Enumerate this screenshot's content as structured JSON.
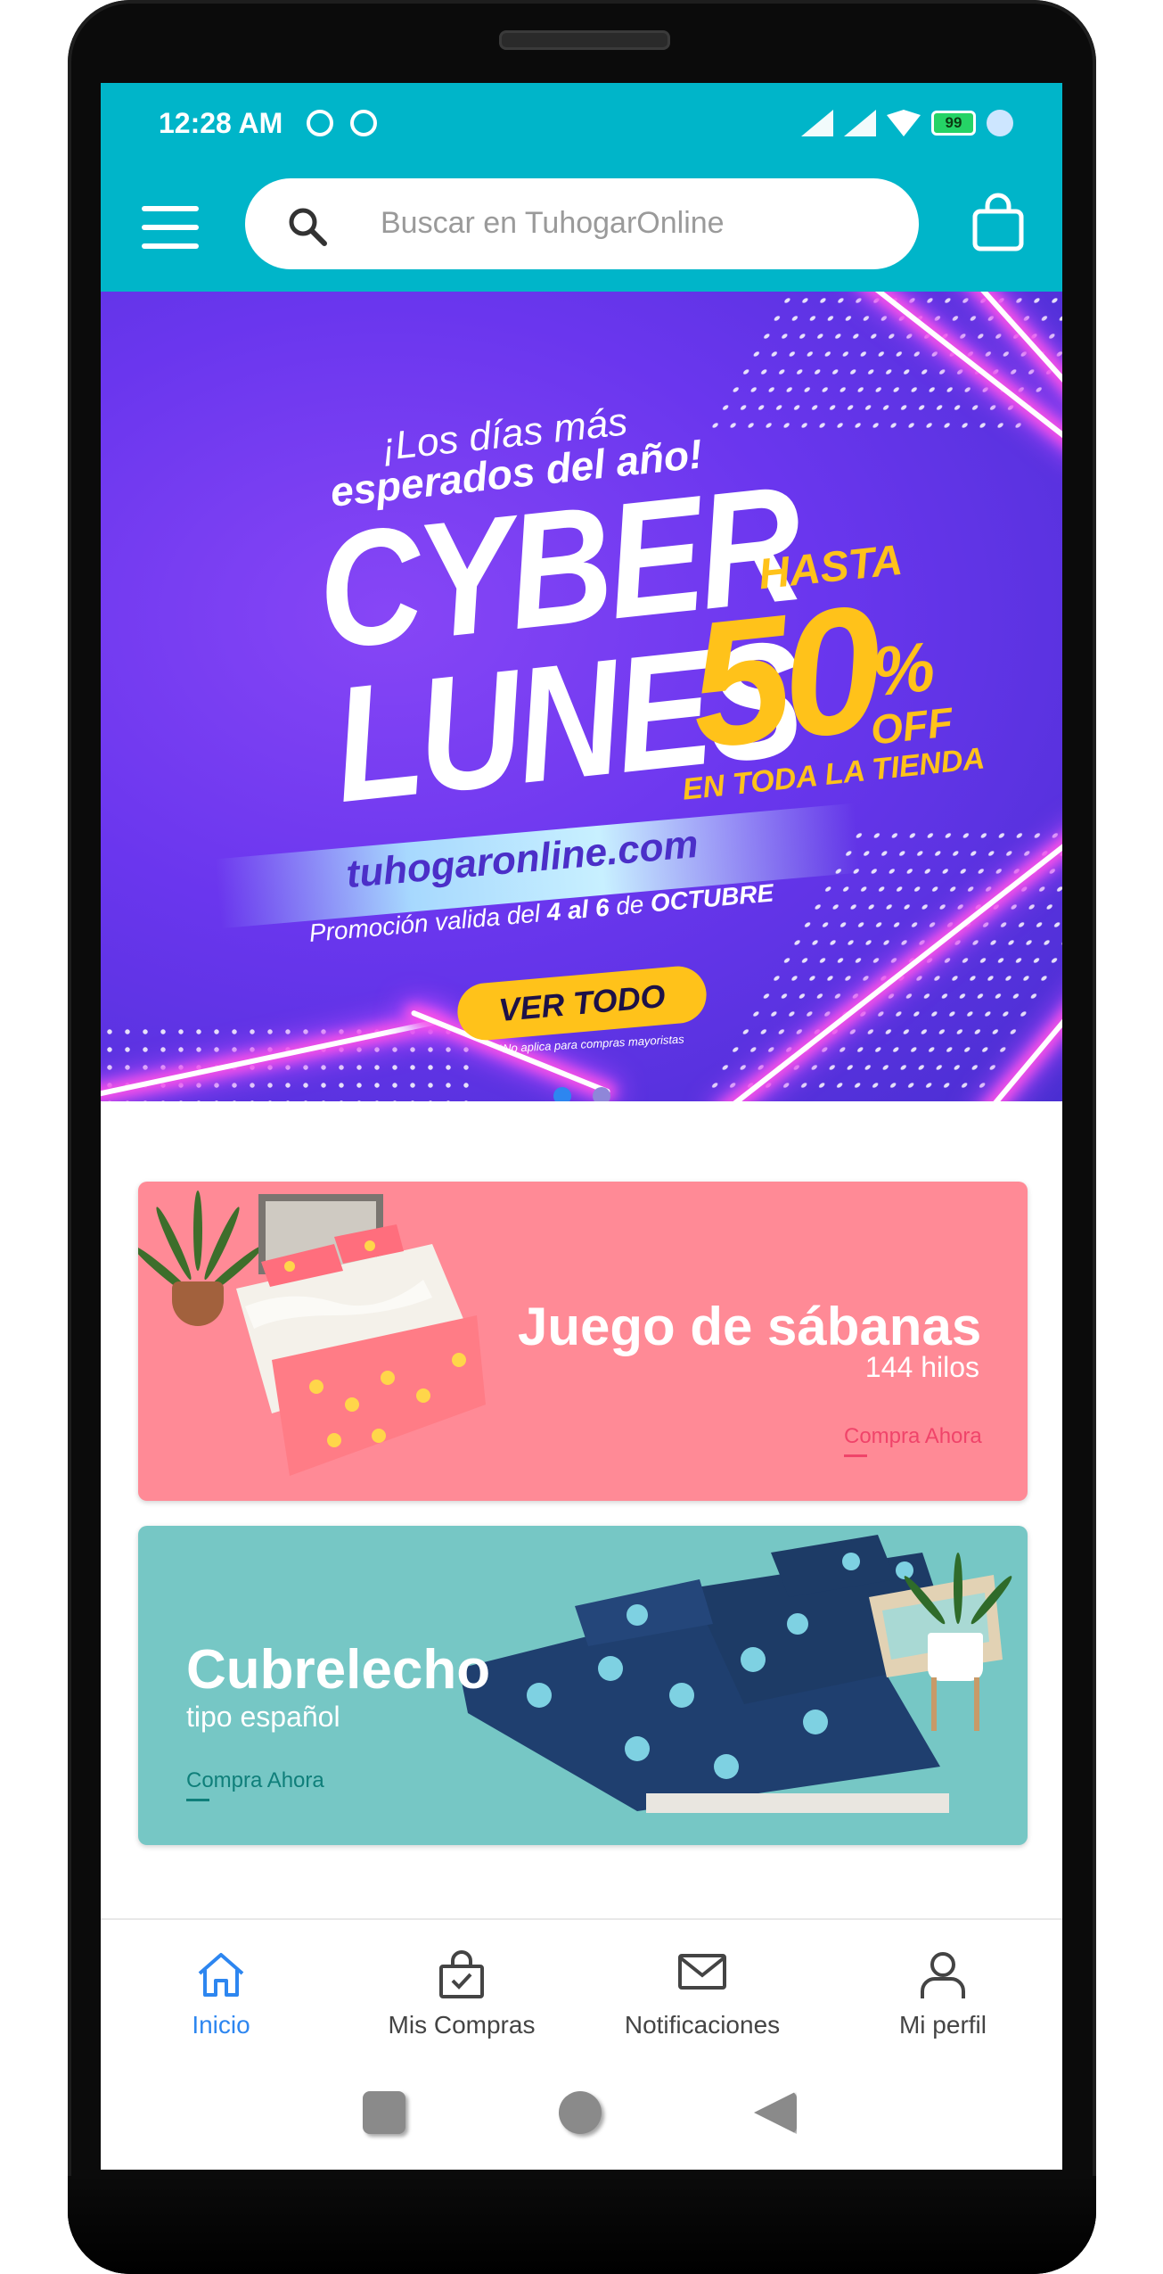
{
  "status_bar": {
    "time": "12:28 AM",
    "battery": "99"
  },
  "app_bar": {
    "search_placeholder": "Buscar en TuhogarOnline"
  },
  "banner": {
    "line1": "¡Los días más",
    "line2": "esperados del año!",
    "headline_1": "CYBER",
    "headline_2": "LUNES",
    "hasta": "HASTA",
    "discount": "50",
    "percent": "%",
    "off": "OFF",
    "scope": "EN TODA LA TIENDA",
    "url": "tuhogaronline.com",
    "promo_prefix": "Promoción valida del ",
    "promo_dates": "4 al 6",
    "promo_mid": " de ",
    "promo_month": "OCTUBRE",
    "button": "VER TODO",
    "footnote": "*No aplica para compras mayoristas",
    "indicator_count": 2,
    "active_indicator": 1
  },
  "cards": [
    {
      "title": "Juego de sábanas",
      "subtitle": "144 hilos",
      "cta": "Compra Ahora"
    },
    {
      "title": "Cubrelecho",
      "subtitle": "tipo español",
      "cta": "Compra Ahora"
    }
  ],
  "bottom_nav": {
    "items": [
      {
        "label": "Inicio",
        "icon": "home-icon",
        "active": true
      },
      {
        "label": "Mis Compras",
        "icon": "shopping-bag-check-icon",
        "active": false
      },
      {
        "label": "Notificaciones",
        "icon": "envelope-icon",
        "active": false
      },
      {
        "label": "Mi perfil",
        "icon": "user-icon",
        "active": false
      }
    ]
  },
  "colors": {
    "primary": "#00b5c9",
    "active_nav": "#2d86f0",
    "banner_yellow": "#ffc21a",
    "card_pink": "#ff8a96",
    "card_teal": "#76c7c5"
  }
}
